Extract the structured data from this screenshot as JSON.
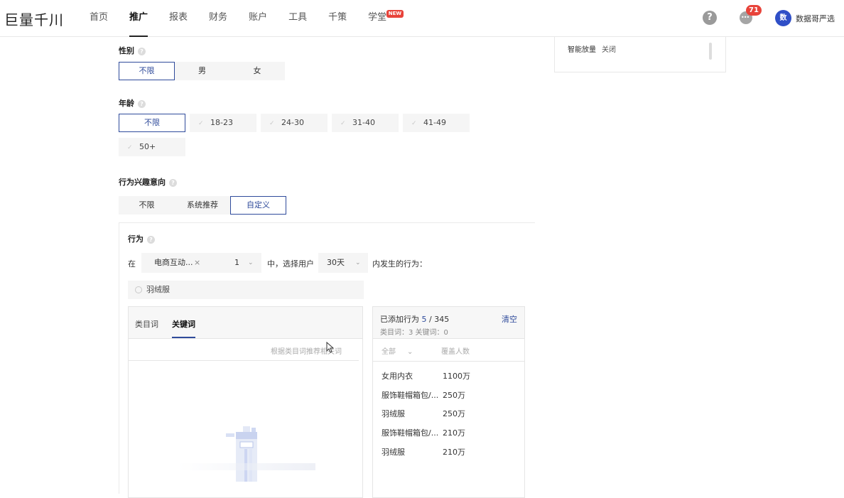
{
  "logo": "巨量千川",
  "nav": {
    "items": [
      "首页",
      "推广",
      "报表",
      "财务",
      "账户",
      "工具",
      "千策",
      "学堂"
    ],
    "active_index": 1,
    "new_badge": "NEW",
    "msg_count": "71",
    "avatar_text": "数",
    "username": "数据哥严选"
  },
  "side_panel": {
    "key": "智能放量",
    "value": "关闭"
  },
  "gender": {
    "label": "性别",
    "options": [
      "不限",
      "男",
      "女"
    ],
    "selected": "不限"
  },
  "age": {
    "label": "年龄",
    "options": [
      "不限",
      "18-23",
      "24-30",
      "31-40",
      "41-49",
      "50+"
    ],
    "selected": "不限"
  },
  "interest": {
    "label": "行为兴趣意向",
    "options": [
      "不限",
      "系统推荐",
      "自定义"
    ],
    "selected": "自定义"
  },
  "behavior": {
    "label": "行为",
    "in_text": "在",
    "scene_value": "电商互动...",
    "scene_count": "1",
    "mid_text": "中，选择用户",
    "days_value": "30天",
    "tail_text": "内发生的行为：",
    "search_value": "羽绒服",
    "tabs": [
      "类目词",
      "关键词"
    ],
    "active_tab": 1,
    "hint": "根据类目词推荐相关词"
  },
  "added": {
    "title_prefix": "已添加行为",
    "added_count": "5",
    "total": "/ 345",
    "sub": "类目词：3   关键词：0",
    "clear": "清空",
    "filter": "全部",
    "col2": "覆盖人数",
    "rows": [
      {
        "name": "女用内衣",
        "count": "1100万"
      },
      {
        "name": "服饰鞋帽箱包/...",
        "count": "250万"
      },
      {
        "name": "羽绒服",
        "count": "250万"
      },
      {
        "name": "服饰鞋帽箱包/...",
        "count": "210万"
      },
      {
        "name": "羽绒服",
        "count": "210万"
      }
    ]
  }
}
